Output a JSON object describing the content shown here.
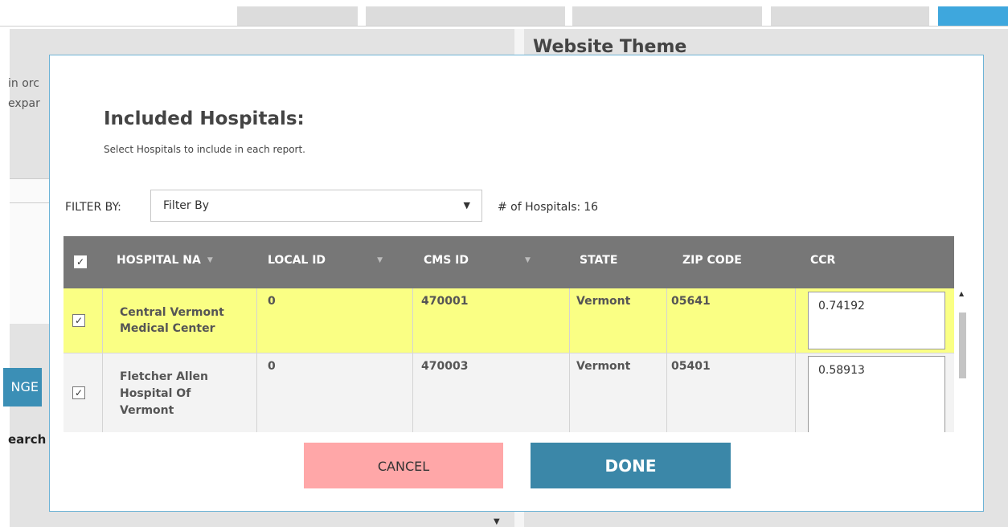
{
  "background": {
    "panel_title": "Website Theme",
    "left_text_line1": "in orc",
    "left_text_line2": "expar",
    "button_label": "NGE",
    "search_label": "earch",
    "colors": {
      "accent_blue": "#3ea7dd",
      "button_blue": "#3b8fb6"
    }
  },
  "modal": {
    "title": "Included Hospitals:",
    "subtitle": "Select Hospitals to include in each report.",
    "filter": {
      "label": "FILTER BY:",
      "selected": "Filter By"
    },
    "count": {
      "label": "# of Hospitals:",
      "value": "16"
    },
    "table": {
      "columns": [
        "HOSPITAL NA",
        "LOCAL ID",
        "CMS ID",
        "STATE",
        "ZIP CODE",
        "CCR"
      ],
      "header_checked": true,
      "rows": [
        {
          "checked": true,
          "selected": true,
          "hospital_name": [
            "Central Vermont",
            "Medical Center"
          ],
          "local_id": "0",
          "cms_id": "470001",
          "state": "Vermont",
          "zip": "05641",
          "ccr": "0.74192"
        },
        {
          "checked": true,
          "selected": false,
          "hospital_name": [
            "Fletcher Allen",
            "Hospital Of",
            "Vermont"
          ],
          "local_id": "0",
          "cms_id": "470003",
          "state": "Vermont",
          "zip": "05401",
          "ccr": "0.58913"
        }
      ]
    },
    "buttons": {
      "cancel": "CANCEL",
      "done": "DONE"
    },
    "colors": {
      "header_bg": "#777777",
      "selected_row": "#faff84",
      "cancel_bg": "#ffa7a8",
      "done_bg": "#3b87a8",
      "border": "#6db3d6"
    }
  },
  "icons": {
    "dropdown": "chevron-down-icon",
    "sort": "sort-down-icon",
    "check": "checkmark-icon",
    "scroll_up": "scroll-up-icon"
  }
}
